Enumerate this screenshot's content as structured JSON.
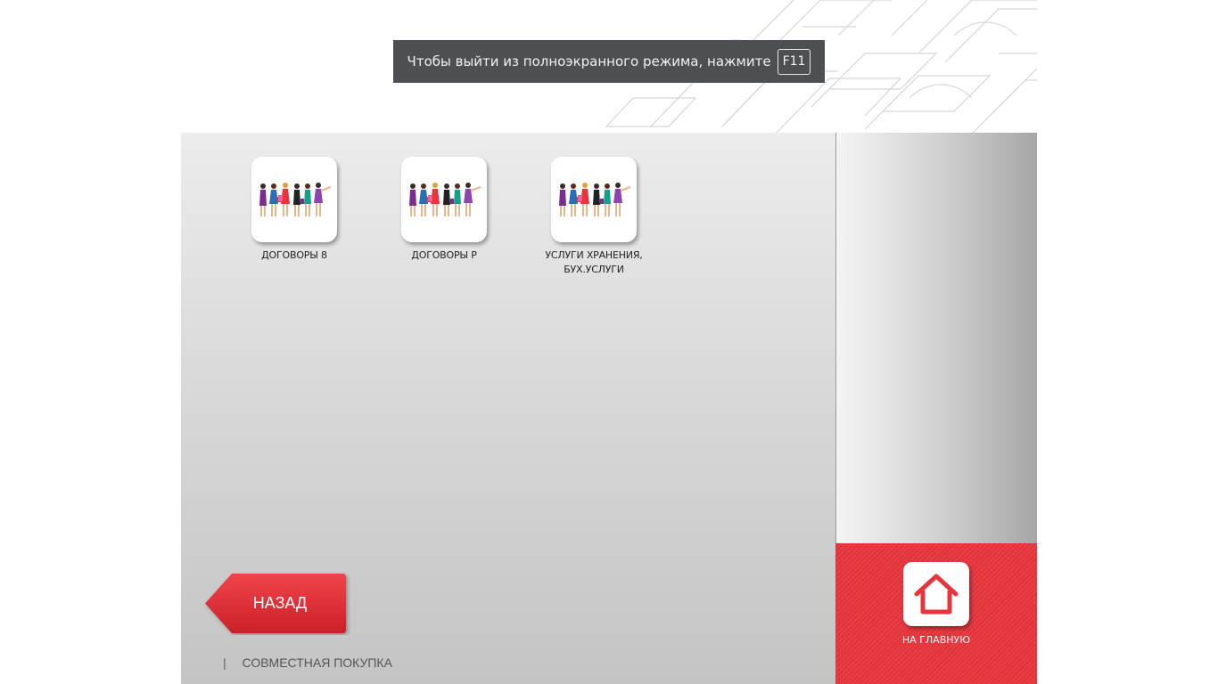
{
  "toast": {
    "message": "Чтобы выйти из полноэкранного режима, нажмите",
    "key": "F11"
  },
  "tiles": [
    {
      "label": "ДОГОВОРЫ 8",
      "icon": "shopping-women-icon"
    },
    {
      "label": "ДОГОВОРЫ Р",
      "icon": "shopping-women-icon"
    },
    {
      "label": "УСЛУГИ ХРАНЕНИЯ, БУХ.УСЛУГИ",
      "icon": "shopping-women-icon"
    }
  ],
  "back_button": {
    "label": "НАЗАД"
  },
  "footer": {
    "separator": "|",
    "text": "СОВМЕСТНАЯ ПОКУПКА"
  },
  "home": {
    "label": "НА ГЛАВНУЮ",
    "icon": "home-icon"
  },
  "colors": {
    "accent_red": "#e8353d",
    "toast_bg": "#4d4f52"
  }
}
